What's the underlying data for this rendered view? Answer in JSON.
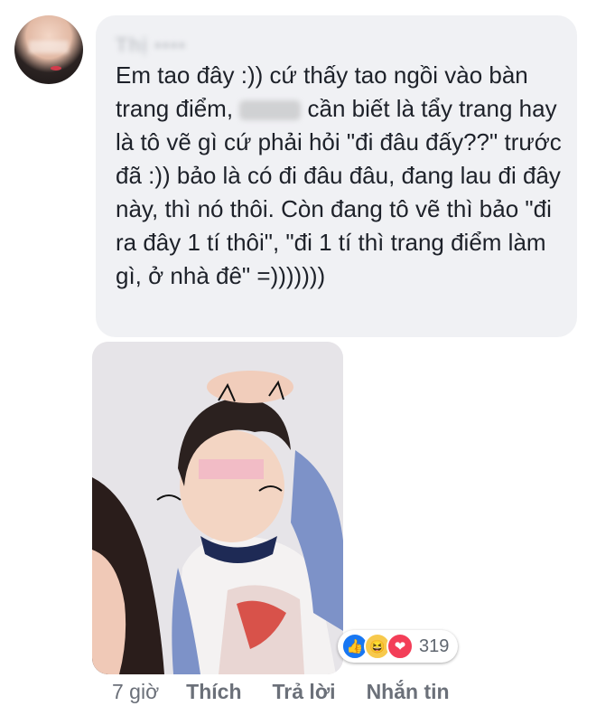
{
  "comment": {
    "author_name": "Thị ▪▪▪▪",
    "text_before_censor": "Em tao đây :)) cứ thấy tao ngồi vào bàn trang điểm, ",
    "censored_word": "",
    "text_after_censor": " cần biết là tẩy trang hay là tô vẽ gì cứ phải hỏi \"đi đâu đấy??\" trước đã :)) bảo là có đi đâu đâu, đang lau đi đây này, thì nó thôi. Còn đang tô vẽ thì bảo \"đi ra đây 1 tí thôi\", \"đi 1 tí thì trang điểm làm gì, ở nhà đê\" =)))))))"
  },
  "reactions": {
    "icons": [
      "like-icon",
      "haha-icon",
      "love-icon"
    ],
    "count": "319",
    "glyphs": {
      "like": "👍",
      "haha": "😆",
      "love": "❤"
    }
  },
  "actions": {
    "time": "7 giờ",
    "like": "Thích",
    "reply": "Trả lời",
    "message": "Nhắn tin"
  },
  "colors": {
    "bubble": "#f0f1f4",
    "text": "#1d2129",
    "meta": "#6b7079",
    "like": "#1877f2",
    "love": "#f33e58"
  }
}
